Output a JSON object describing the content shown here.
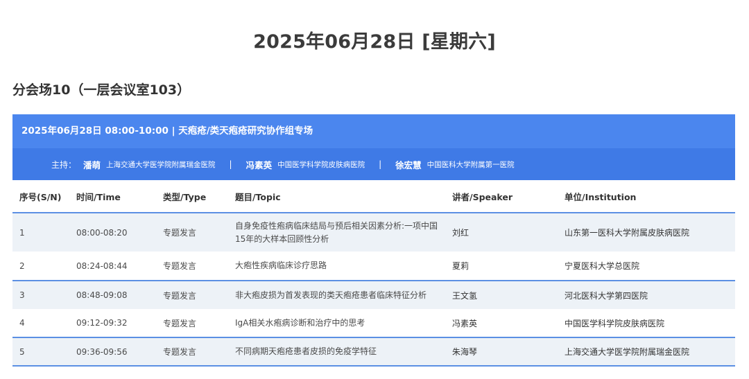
{
  "page": {
    "date_title": "2025年06月28日 [星期六]",
    "venue_title": "分会场10（一层会议室103）"
  },
  "session": {
    "header": "2025年06月28日 08:00-10:00 | 天疱疮/类天疱疮研究协作组专场",
    "host_label": "主持：",
    "separator": "|",
    "hosts": [
      {
        "name": "潘萌",
        "institution": "上海交通大学医学院附属瑞金医院"
      },
      {
        "name": "冯素英",
        "institution": "中国医学科学院皮肤病医院"
      },
      {
        "name": "徐宏慧",
        "institution": "中国医科大学附属第一医院"
      }
    ]
  },
  "table": {
    "columns": [
      "序号(S/N)",
      "时间/Time",
      "类型/Type",
      "题目/Topic",
      "讲者/Speaker",
      "单位/Institution"
    ],
    "rows": [
      {
        "sn": "1",
        "time": "08:00-08:20",
        "type": "专题发言",
        "topic": "自身免疫性疱病临床结局与预后相关因素分析:一项中国15年的大样本回顾性分析",
        "speaker": "刘红",
        "institution": "山东第一医科大学附属皮肤病医院"
      },
      {
        "sn": "2",
        "time": "08:24-08:44",
        "type": "专题发言",
        "topic": "大疱性疾病临床诊疗思路",
        "speaker": "夏莉",
        "institution": "宁夏医科大学总医院"
      },
      {
        "sn": "3",
        "time": "08:48-09:08",
        "type": "专题发言",
        "topic": "非大疱皮损为首发表现的类天疱疮患者临床特征分析",
        "speaker": "王文氢",
        "institution": "河北医科大学第四医院"
      },
      {
        "sn": "4",
        "time": "09:12-09:32",
        "type": "专题发言",
        "topic": "IgA相关水疱病诊断和治疗中的思考",
        "speaker": "冯素英",
        "institution": "中国医学科学院皮肤病医院"
      },
      {
        "sn": "5",
        "time": "09:36-09:56",
        "type": "专题发言",
        "topic": "不同病期天疱疮患者皮损的免疫学特征",
        "speaker": "朱海琴",
        "institution": "上海交通大学医学院附属瑞金医院"
      }
    ]
  }
}
